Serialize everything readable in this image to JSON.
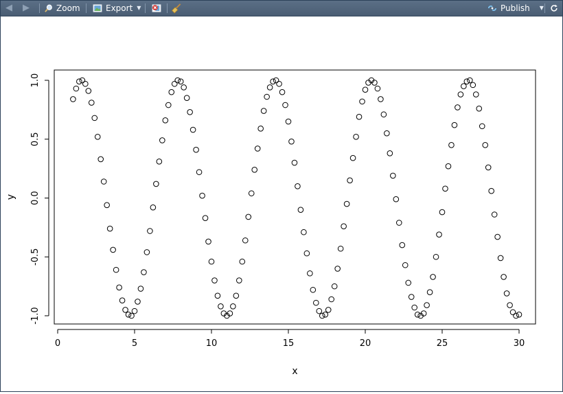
{
  "toolbar": {
    "back_icon": "back-arrow-icon",
    "forward_icon": "forward-arrow-icon",
    "zoom_label": "Zoom",
    "export_label": "Export",
    "clear_icon": "remove-plot-icon",
    "broom_icon": "clear-all-plots-icon",
    "publish_label": "Publish",
    "refresh_icon": "refresh-icon",
    "background_color": "#4f6379"
  },
  "chart_data": {
    "type": "scatter",
    "title": "",
    "xlabel": "x",
    "ylabel": "y",
    "xlim": [
      0,
      30
    ],
    "ylim": [
      -1.0,
      1.0
    ],
    "x_ticks": [
      "0",
      "5",
      "10",
      "15",
      "20",
      "25",
      "30"
    ],
    "y_ticks": [
      "-1.0",
      "-0.5",
      "0.0",
      "0.5",
      "1.0"
    ],
    "marker": "open-circle",
    "grid": false,
    "legend": "none",
    "x": [
      1.0,
      1.2,
      1.4,
      1.6,
      1.8,
      2.0,
      2.2,
      2.4,
      2.6,
      2.8,
      3.0,
      3.2,
      3.4,
      3.6,
      3.8,
      4.0,
      4.2,
      4.4,
      4.6,
      4.8,
      5.0,
      5.2,
      5.4,
      5.6,
      5.8,
      6.0,
      6.2,
      6.4,
      6.6,
      6.8,
      7.0,
      7.2,
      7.4,
      7.6,
      7.8,
      8.0,
      8.2,
      8.4,
      8.6,
      8.8,
      9.0,
      9.2,
      9.4,
      9.6,
      9.8,
      10.0,
      10.2,
      10.4,
      10.6,
      10.8,
      11.0,
      11.2,
      11.4,
      11.6,
      11.8,
      12.0,
      12.2,
      12.4,
      12.6,
      12.8,
      13.0,
      13.2,
      13.4,
      13.6,
      13.8,
      14.0,
      14.2,
      14.4,
      14.6,
      14.8,
      15.0,
      15.2,
      15.4,
      15.6,
      15.8,
      16.0,
      16.2,
      16.4,
      16.6,
      16.8,
      17.0,
      17.2,
      17.4,
      17.6,
      17.8,
      18.0,
      18.2,
      18.4,
      18.6,
      18.8,
      19.0,
      19.2,
      19.4,
      19.6,
      19.8,
      20.0,
      20.2,
      20.4,
      20.6,
      20.8,
      21.0,
      21.2,
      21.4,
      21.6,
      21.8,
      22.0,
      22.2,
      22.4,
      22.6,
      22.8,
      23.0,
      23.2,
      23.4,
      23.6,
      23.8,
      24.0,
      24.2,
      24.4,
      24.6,
      24.8,
      25.0,
      25.2,
      25.4,
      25.6,
      25.8,
      26.0,
      26.2,
      26.4,
      26.6,
      26.8,
      27.0,
      27.2,
      27.4,
      27.6,
      27.8,
      28.0,
      28.2,
      28.4,
      28.6,
      28.8,
      29.0,
      29.2,
      29.4,
      29.6,
      29.8,
      30.0
    ],
    "y": [
      0.84,
      0.93,
      0.99,
      1.0,
      0.97,
      0.91,
      0.81,
      0.68,
      0.52,
      0.33,
      0.14,
      -0.06,
      -0.26,
      -0.44,
      -0.61,
      -0.76,
      -0.87,
      -0.95,
      -0.99,
      -1.0,
      -0.96,
      -0.88,
      -0.77,
      -0.63,
      -0.46,
      -0.28,
      -0.08,
      0.12,
      0.31,
      0.49,
      0.66,
      0.79,
      0.9,
      0.97,
      1.0,
      0.99,
      0.94,
      0.85,
      0.73,
      0.58,
      0.41,
      0.22,
      0.02,
      -0.17,
      -0.37,
      -0.54,
      -0.7,
      -0.83,
      -0.92,
      -0.98,
      -1.0,
      -0.98,
      -0.92,
      -0.83,
      -0.7,
      -0.54,
      -0.36,
      -0.16,
      0.04,
      0.24,
      0.42,
      0.59,
      0.74,
      0.86,
      0.94,
      0.99,
      1.0,
      0.97,
      0.9,
      0.79,
      0.65,
      0.48,
      0.3,
      0.1,
      -0.1,
      -0.29,
      -0.47,
      -0.64,
      -0.78,
      -0.89,
      -0.96,
      -1.0,
      -0.99,
      -0.95,
      -0.86,
      -0.75,
      -0.6,
      -0.43,
      -0.24,
      -0.05,
      0.15,
      0.34,
      0.52,
      0.69,
      0.82,
      0.92,
      0.98,
      1.0,
      0.98,
      0.93,
      0.84,
      0.71,
      0.55,
      0.38,
      0.19,
      -0.01,
      -0.21,
      -0.4,
      -0.57,
      -0.72,
      -0.84,
      -0.93,
      -0.99,
      -1.0,
      -0.98,
      -0.91,
      -0.8,
      -0.67,
      -0.5,
      -0.31,
      -0.12,
      0.08,
      0.27,
      0.45,
      0.62,
      0.77,
      0.88,
      0.95,
      0.99,
      1.0,
      0.96,
      0.88,
      0.76,
      0.61,
      0.45,
      0.26,
      0.06,
      -0.14,
      -0.33,
      -0.51,
      -0.67,
      -0.81,
      -0.91,
      -0.97,
      -1.0,
      -0.99
    ]
  }
}
